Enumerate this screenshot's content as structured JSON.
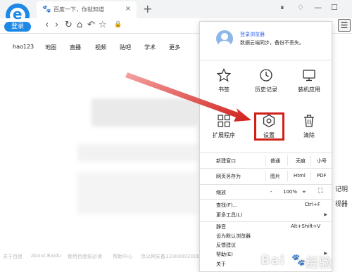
{
  "browser": {
    "logo_letter": "e",
    "login_label": "登录",
    "tab_title": "百度一下，你就知道",
    "tab_close": "×",
    "new_tab": "+"
  },
  "page": {
    "nav_links": [
      "hao123",
      "地图",
      "直播",
      "视频",
      "贴吧",
      "学术",
      "更多"
    ],
    "footer_links": [
      "关于百度",
      "About Baidu",
      "使用百度前必读",
      "帮助中心",
      "京公网安备11000002000"
    ],
    "side_texts": [
      "记明",
      "视器"
    ]
  },
  "menu": {
    "account_title": "登录浏览器",
    "account_subtitle": "数据云端同步，备份不丢失。",
    "grid": [
      {
        "label": "书签",
        "icon": "star-icon"
      },
      {
        "label": "历史记录",
        "icon": "clock-icon"
      },
      {
        "label": "装机应用",
        "icon": "monitor-icon"
      },
      {
        "label": "扩展程序",
        "icon": "grid-icon"
      },
      {
        "label": "设置",
        "icon": "settings-hexagon-icon"
      },
      {
        "label": "清除",
        "icon": "trash-icon"
      }
    ],
    "new_window": {
      "label": "新建窗口",
      "options": [
        "普通",
        "无痕",
        "小号"
      ]
    },
    "save_page": {
      "label": "网页另存为",
      "options": [
        "图片",
        "Html",
        "PDF"
      ]
    },
    "zoom": {
      "label": "缩放",
      "minus": "-",
      "value": "100%",
      "plus": "+"
    },
    "find": {
      "label": "查找(F)...",
      "shortcut": "Ctrl+F"
    },
    "more_tools": {
      "label": "更多工具(L)"
    },
    "mute": {
      "label": "静音",
      "shortcut": "Alt+Shift+V"
    },
    "default_browser": {
      "label": "设为默认浏览器"
    },
    "feedback": {
      "label": "反馈建议"
    },
    "help": {
      "label": "帮助(E)"
    },
    "about": {
      "label": "关于"
    }
  },
  "watermark": {
    "text": "Bai",
    "text2": "经验"
  },
  "colors": {
    "accent": "#1e88e5",
    "highlight": "#d0201a",
    "link": "#2a5ee8"
  }
}
